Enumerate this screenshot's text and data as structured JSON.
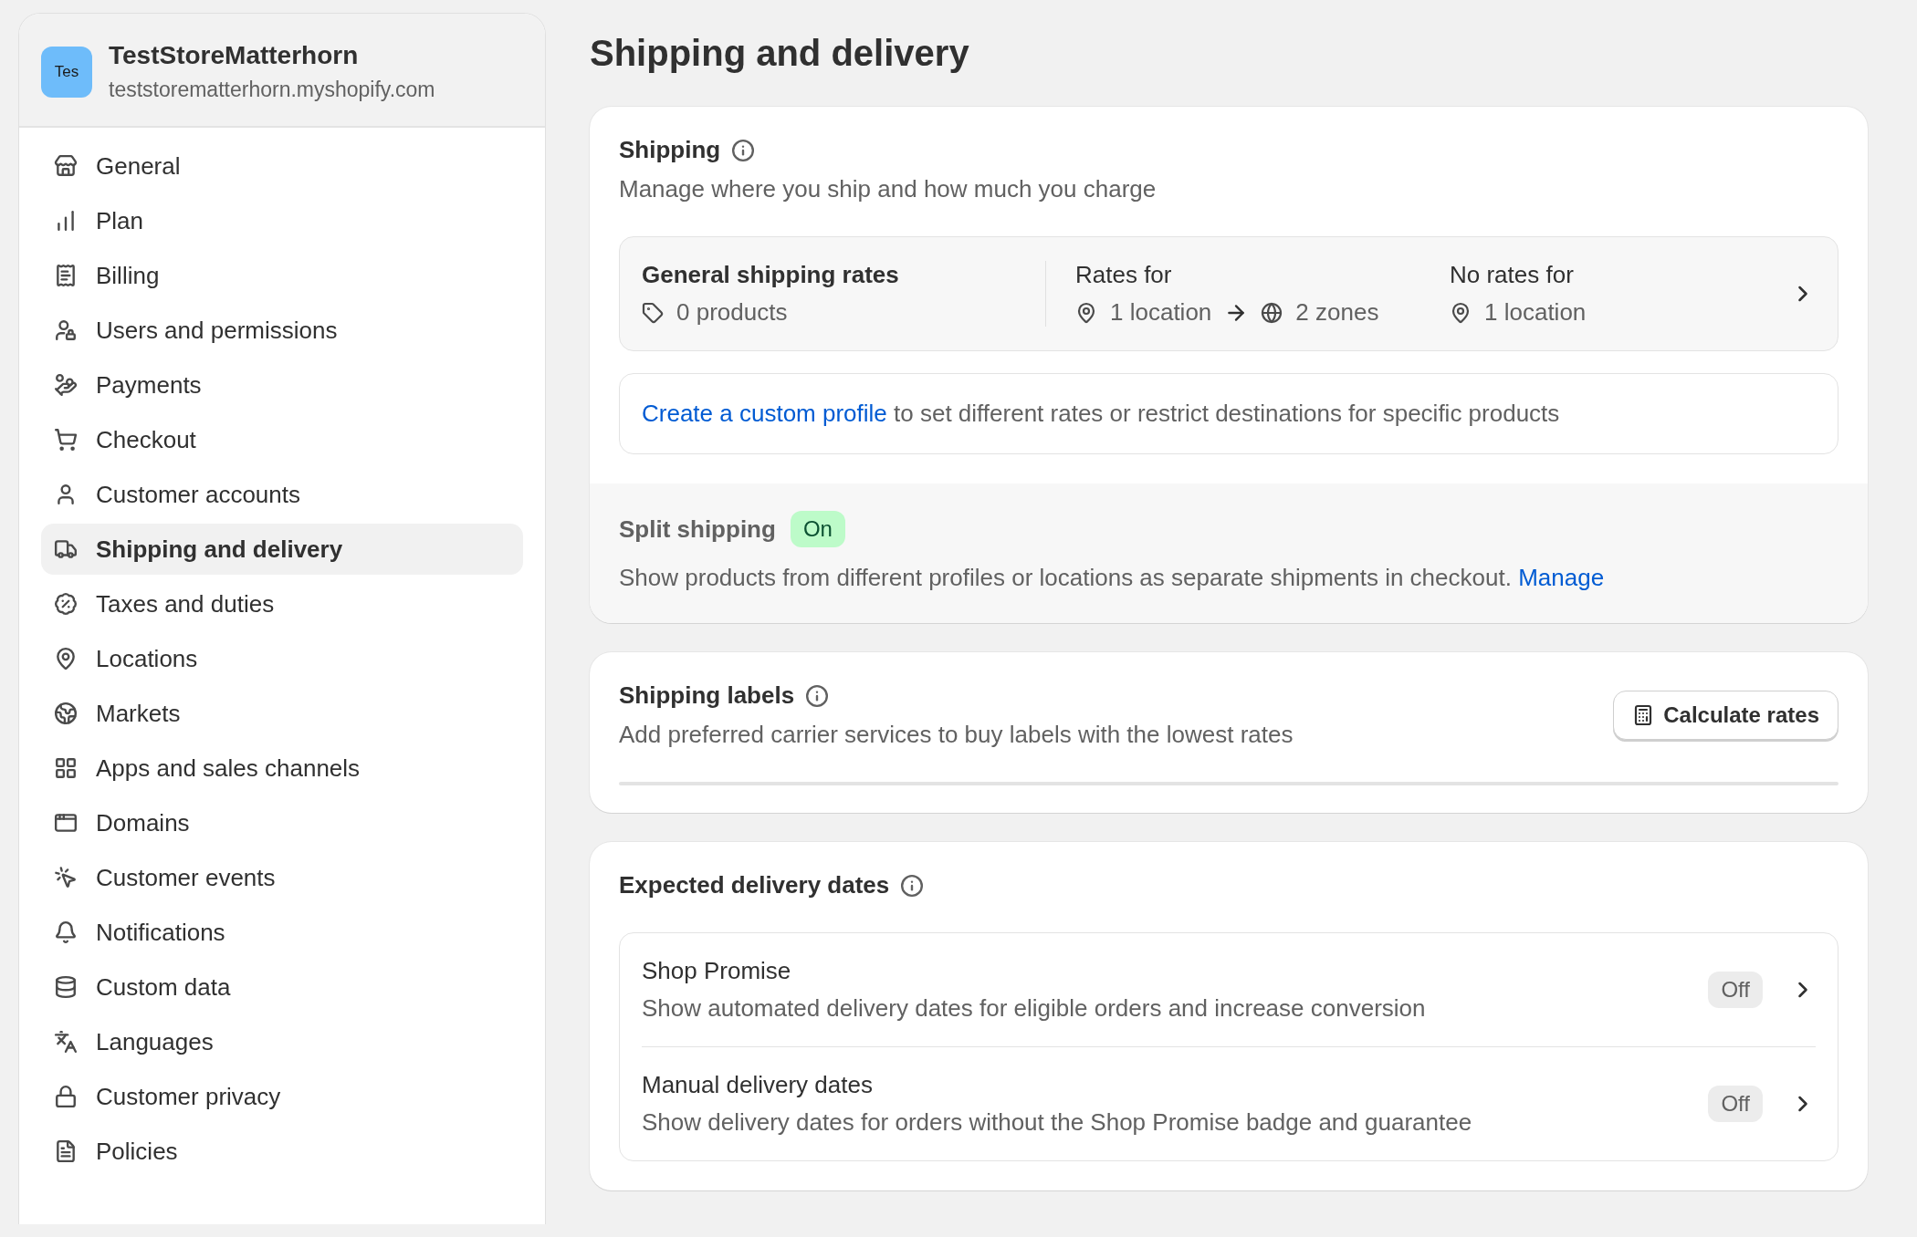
{
  "store": {
    "avatar": "Tes",
    "name": "TestStoreMatterhorn",
    "domain": "teststorematterhorn.myshopify.com"
  },
  "sidebar": {
    "items": [
      {
        "label": "General",
        "selected": false
      },
      {
        "label": "Plan",
        "selected": false
      },
      {
        "label": "Billing",
        "selected": false
      },
      {
        "label": "Users and permissions",
        "selected": false
      },
      {
        "label": "Payments",
        "selected": false
      },
      {
        "label": "Checkout",
        "selected": false
      },
      {
        "label": "Customer accounts",
        "selected": false
      },
      {
        "label": "Shipping and delivery",
        "selected": true
      },
      {
        "label": "Taxes and duties",
        "selected": false
      },
      {
        "label": "Locations",
        "selected": false
      },
      {
        "label": "Markets",
        "selected": false
      },
      {
        "label": "Apps and sales channels",
        "selected": false
      },
      {
        "label": "Domains",
        "selected": false
      },
      {
        "label": "Customer events",
        "selected": false
      },
      {
        "label": "Notifications",
        "selected": false
      },
      {
        "label": "Custom data",
        "selected": false
      },
      {
        "label": "Languages",
        "selected": false
      },
      {
        "label": "Customer privacy",
        "selected": false
      },
      {
        "label": "Policies",
        "selected": false
      }
    ]
  },
  "page_title": "Shipping and delivery",
  "shipping": {
    "title": "Shipping",
    "description": "Manage where you ship and how much you charge",
    "profile": {
      "name": "General shipping rates",
      "products": "0 products",
      "rates_label": "Rates for",
      "from": "1 location",
      "to": "2 zones",
      "no_rates_label": "No rates for",
      "no_rates": "1 location"
    },
    "custom_profile": {
      "link": "Create a custom profile",
      "text": "to set different rates or restrict destinations for specific products"
    },
    "split": {
      "title": "Split shipping",
      "status": "On",
      "on": true,
      "description": "Show products from different profiles or locations as separate shipments in checkout.",
      "link": "Manage"
    }
  },
  "labels": {
    "title": "Shipping labels",
    "description": "Add preferred carrier services to buy labels with the lowest rates",
    "button": "Calculate rates"
  },
  "delivery": {
    "title": "Expected delivery dates",
    "items": [
      {
        "title": "Shop Promise",
        "description": "Show automated delivery dates for eligible orders and increase conversion",
        "status": "Off",
        "on": false
      },
      {
        "title": "Manual delivery dates",
        "description": "Show delivery dates for orders without the Shop Promise badge and guarantee",
        "status": "Off",
        "on": false
      }
    ]
  }
}
